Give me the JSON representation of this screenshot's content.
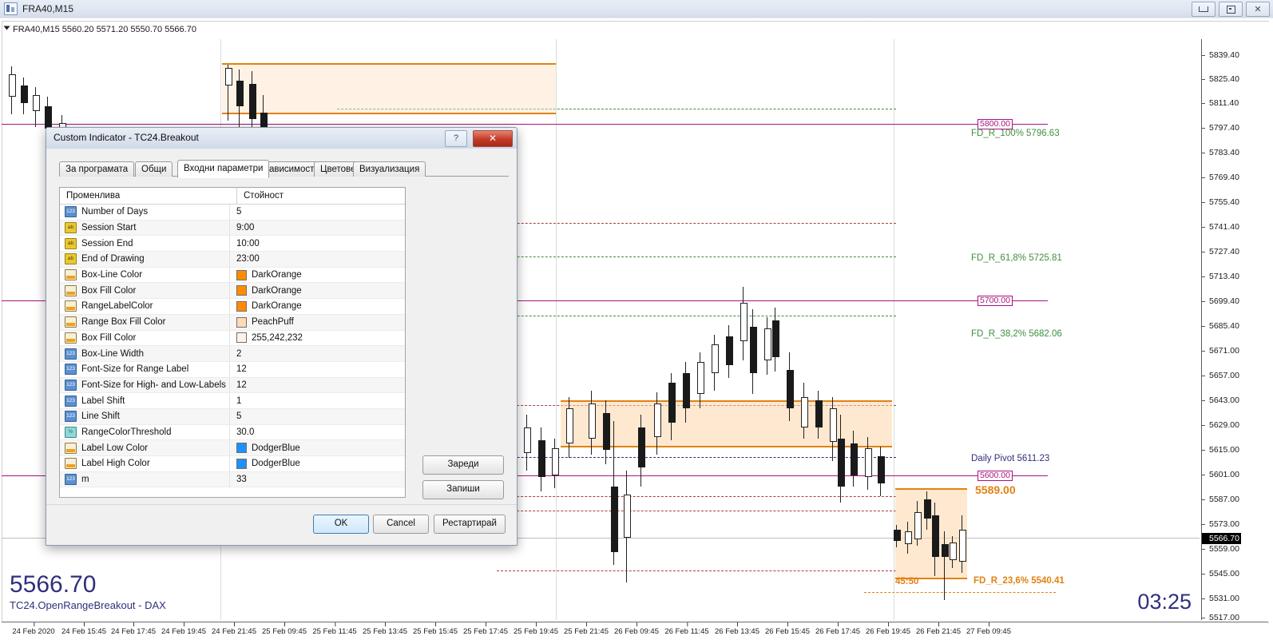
{
  "window": {
    "title": "FRA40,M15",
    "icon": "chart-icon",
    "buttons": {
      "minimize": "minimize-icon",
      "maximize": "maximize-icon",
      "close": "close-icon"
    }
  },
  "chart": {
    "quote_line": "FRA40,M15  5560.20 5571.20 5550.70 5566.70",
    "symbol": "FRA40,M15",
    "open": "5560.20",
    "high": "5571.20",
    "low": "5550.70",
    "close": "5566.70",
    "readout_price": "5566.70",
    "readout_label": "TC24.OpenRangeBreakout - DAX",
    "clock": "03:25",
    "current_price": "5566.70",
    "y_ticks": [
      "5839.40",
      "5825.40",
      "5811.40",
      "5797.40",
      "5783.40",
      "5769.40",
      "5755.40",
      "5741.40",
      "5727.40",
      "5713.40",
      "5699.40",
      "5685.40",
      "5671.00",
      "5657.00",
      "5643.00",
      "5629.00",
      "5615.00",
      "5601.00",
      "5587.00",
      "5573.00",
      "5559.00",
      "5545.00",
      "5531.00",
      "5517.00"
    ],
    "x_ticks": [
      "24 Feb 2020",
      "24 Feb 15:45",
      "24 Feb 17:45",
      "24 Feb 19:45",
      "24 Feb 21:45",
      "25 Feb 09:45",
      "25 Feb 11:45",
      "25 Feb 13:45",
      "25 Feb 15:45",
      "25 Feb 17:45",
      "25 Feb 19:45",
      "25 Feb 21:45",
      "26 Feb 09:45",
      "26 Feb 11:45",
      "26 Feb 13:45",
      "26 Feb 15:45",
      "26 Feb 17:45",
      "26 Feb 19:45",
      "26 Feb 21:45",
      "27 Feb 09:45"
    ],
    "price_tags": [
      "5800.00",
      "5700.00",
      "5600.00"
    ],
    "annotations": [
      {
        "text": "FD_R_100% 5796.63",
        "color": "green"
      },
      {
        "text": "FD_R_61,8% 5725.81",
        "color": "green"
      },
      {
        "text": "FD_R_38,2% 5682.06",
        "color": "green"
      },
      {
        "text": "Daily Pivot 5611.23",
        "color": "blue"
      },
      {
        "text": "5589.00",
        "color": "orange"
      },
      {
        "text": "FD_R_23,6% 5540.41",
        "color": "orange"
      },
      {
        "text": "45:50",
        "color": "orange"
      }
    ],
    "colors": {
      "price_line": "#a8137f",
      "fib_green": "#3f8f3f",
      "pivot_blue": "#30307c",
      "range_orange": "#e08214",
      "range_fill": "#ffd6aa"
    }
  },
  "dialog": {
    "title": "Custom Indicator - TC24.Breakout",
    "help_label": "?",
    "close_label": "✕",
    "tabs": [
      {
        "label": "За програмата",
        "active": false
      },
      {
        "label": "Общи",
        "active": false
      },
      {
        "label": "Входни параметри",
        "active": true
      },
      {
        "label": "Зависимости",
        "active": false
      },
      {
        "label": "Цветове",
        "active": false
      },
      {
        "label": "Визуализация",
        "active": false
      }
    ],
    "grid": {
      "headers": {
        "variable": "Променлива",
        "value": "Стойност"
      },
      "rows": [
        {
          "icon": "number-icon",
          "name": "Number of Days",
          "value": "5",
          "swatch": null
        },
        {
          "icon": "string-icon",
          "name": "Session Start",
          "value": "9:00",
          "swatch": null
        },
        {
          "icon": "string-icon",
          "name": "Session End",
          "value": "10:00",
          "swatch": null
        },
        {
          "icon": "string-icon",
          "name": "End of Drawing",
          "value": "23:00",
          "swatch": null
        },
        {
          "icon": "color-icon",
          "name": "Box-Line Color",
          "value": "DarkOrange",
          "swatch": "#ff8c00"
        },
        {
          "icon": "color-icon",
          "name": "Box Fill Color",
          "value": "DarkOrange",
          "swatch": "#ff8c00"
        },
        {
          "icon": "color-icon",
          "name": "RangeLabelColor",
          "value": "DarkOrange",
          "swatch": "#ff8c00"
        },
        {
          "icon": "color-icon",
          "name": "Range Box Fill Color",
          "value": "PeachPuff",
          "swatch": "#ffdab9"
        },
        {
          "icon": "color-icon",
          "name": "Box Fill Color",
          "value": "255,242,232",
          "swatch": "#fff2e8"
        },
        {
          "icon": "number-icon",
          "name": "Box-Line Width",
          "value": "2",
          "swatch": null
        },
        {
          "icon": "number-icon",
          "name": "Font-Size for Range Label",
          "value": "12",
          "swatch": null
        },
        {
          "icon": "number-icon",
          "name": "Font-Size for High- and Low-Labels",
          "value": "12",
          "swatch": null
        },
        {
          "icon": "number-icon",
          "name": "Label Shift",
          "value": "1",
          "swatch": null
        },
        {
          "icon": "number-icon",
          "name": "Line Shift",
          "value": "5",
          "swatch": null
        },
        {
          "icon": "float-icon",
          "name": "RangeColorThreshold",
          "value": "30.0",
          "swatch": null
        },
        {
          "icon": "color-icon",
          "name": "Label Low Color",
          "value": "DodgerBlue",
          "swatch": "#1e90ff"
        },
        {
          "icon": "color-icon",
          "name": "Label High Color",
          "value": "DodgerBlue",
          "swatch": "#1e90ff"
        },
        {
          "icon": "number-icon",
          "name": "m",
          "value": "33",
          "swatch": null
        }
      ]
    },
    "side_buttons": {
      "load": "Зареди",
      "save": "Запиши"
    },
    "footer_buttons": {
      "ok": "OK",
      "cancel": "Cancel",
      "restart": "Рестартирай"
    }
  }
}
